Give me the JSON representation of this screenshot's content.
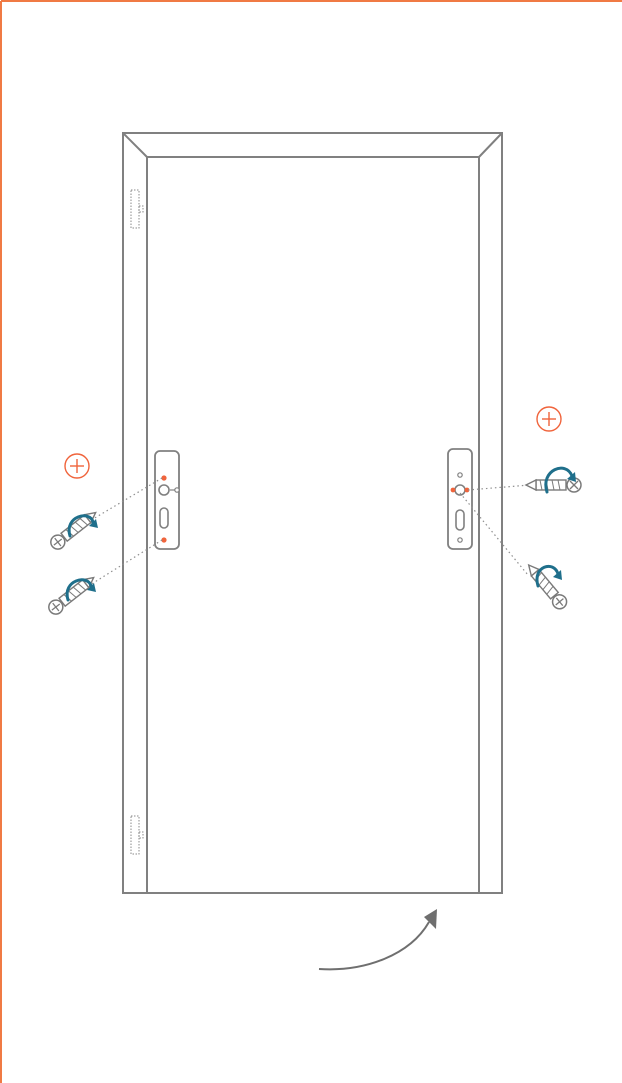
{
  "diagram": {
    "page_border_color": "#f07a44",
    "line_color": "#808080",
    "accent_color": "#f0643c",
    "rotation_arrow_color": "#1f6f8b",
    "left_screw_group": {
      "sign": "+",
      "screw_count": 2
    },
    "right_screw_group": {
      "sign": "+",
      "screw_count": 2
    },
    "icons": [
      "door-frame-icon",
      "hinge-icon",
      "lock-plate-icon",
      "screw-icon",
      "plus-circle-icon",
      "rotate-arrow-icon",
      "swing-direction-arrow-icon"
    ]
  }
}
